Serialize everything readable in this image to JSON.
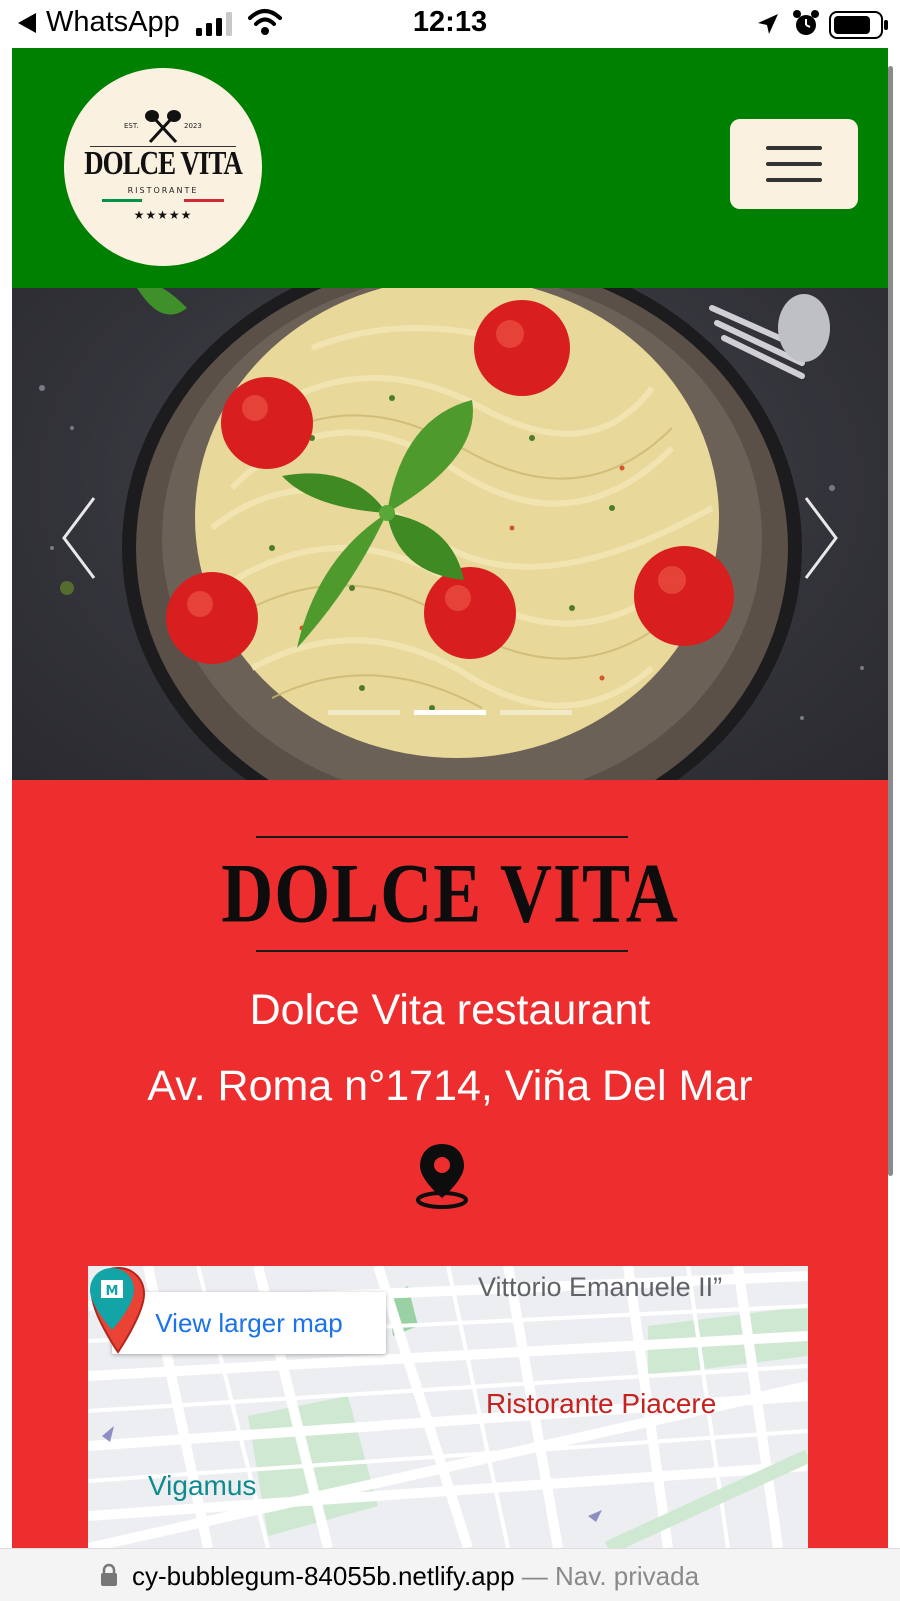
{
  "status_bar": {
    "back_app": "WhatsApp",
    "time": "12:13"
  },
  "header": {
    "logo": {
      "est": "EST.",
      "year": "2023",
      "name": "DOLCE VITA",
      "subtitle": "RISTORANTE",
      "stars": "★★★★★"
    },
    "menu_icon": "hamburger-icon"
  },
  "carousel": {
    "slide_count": 3,
    "active_index": 1,
    "prev_icon": "chevron-left-icon",
    "next_icon": "chevron-right-icon"
  },
  "info": {
    "brand_title": "DOLCE VITA",
    "restaurant_name": "Dolce Vita restaurant",
    "address": "Av. Roma n°1714, Viña Del Mar",
    "location_icon": "map-pin-icon"
  },
  "map": {
    "view_larger": "View larger map",
    "street_label": "Vittorio Emanuele II”",
    "place_label": "Ristorante Piacere",
    "poi_label": "Vigamus"
  },
  "url_bar": {
    "url": "cy-bubblegum-84055b.netlify.app",
    "mode": " — Nav. privada"
  },
  "colors": {
    "header_green": "#008000",
    "section_red": "#ee2e2e",
    "cream": "#fbf1e0"
  }
}
